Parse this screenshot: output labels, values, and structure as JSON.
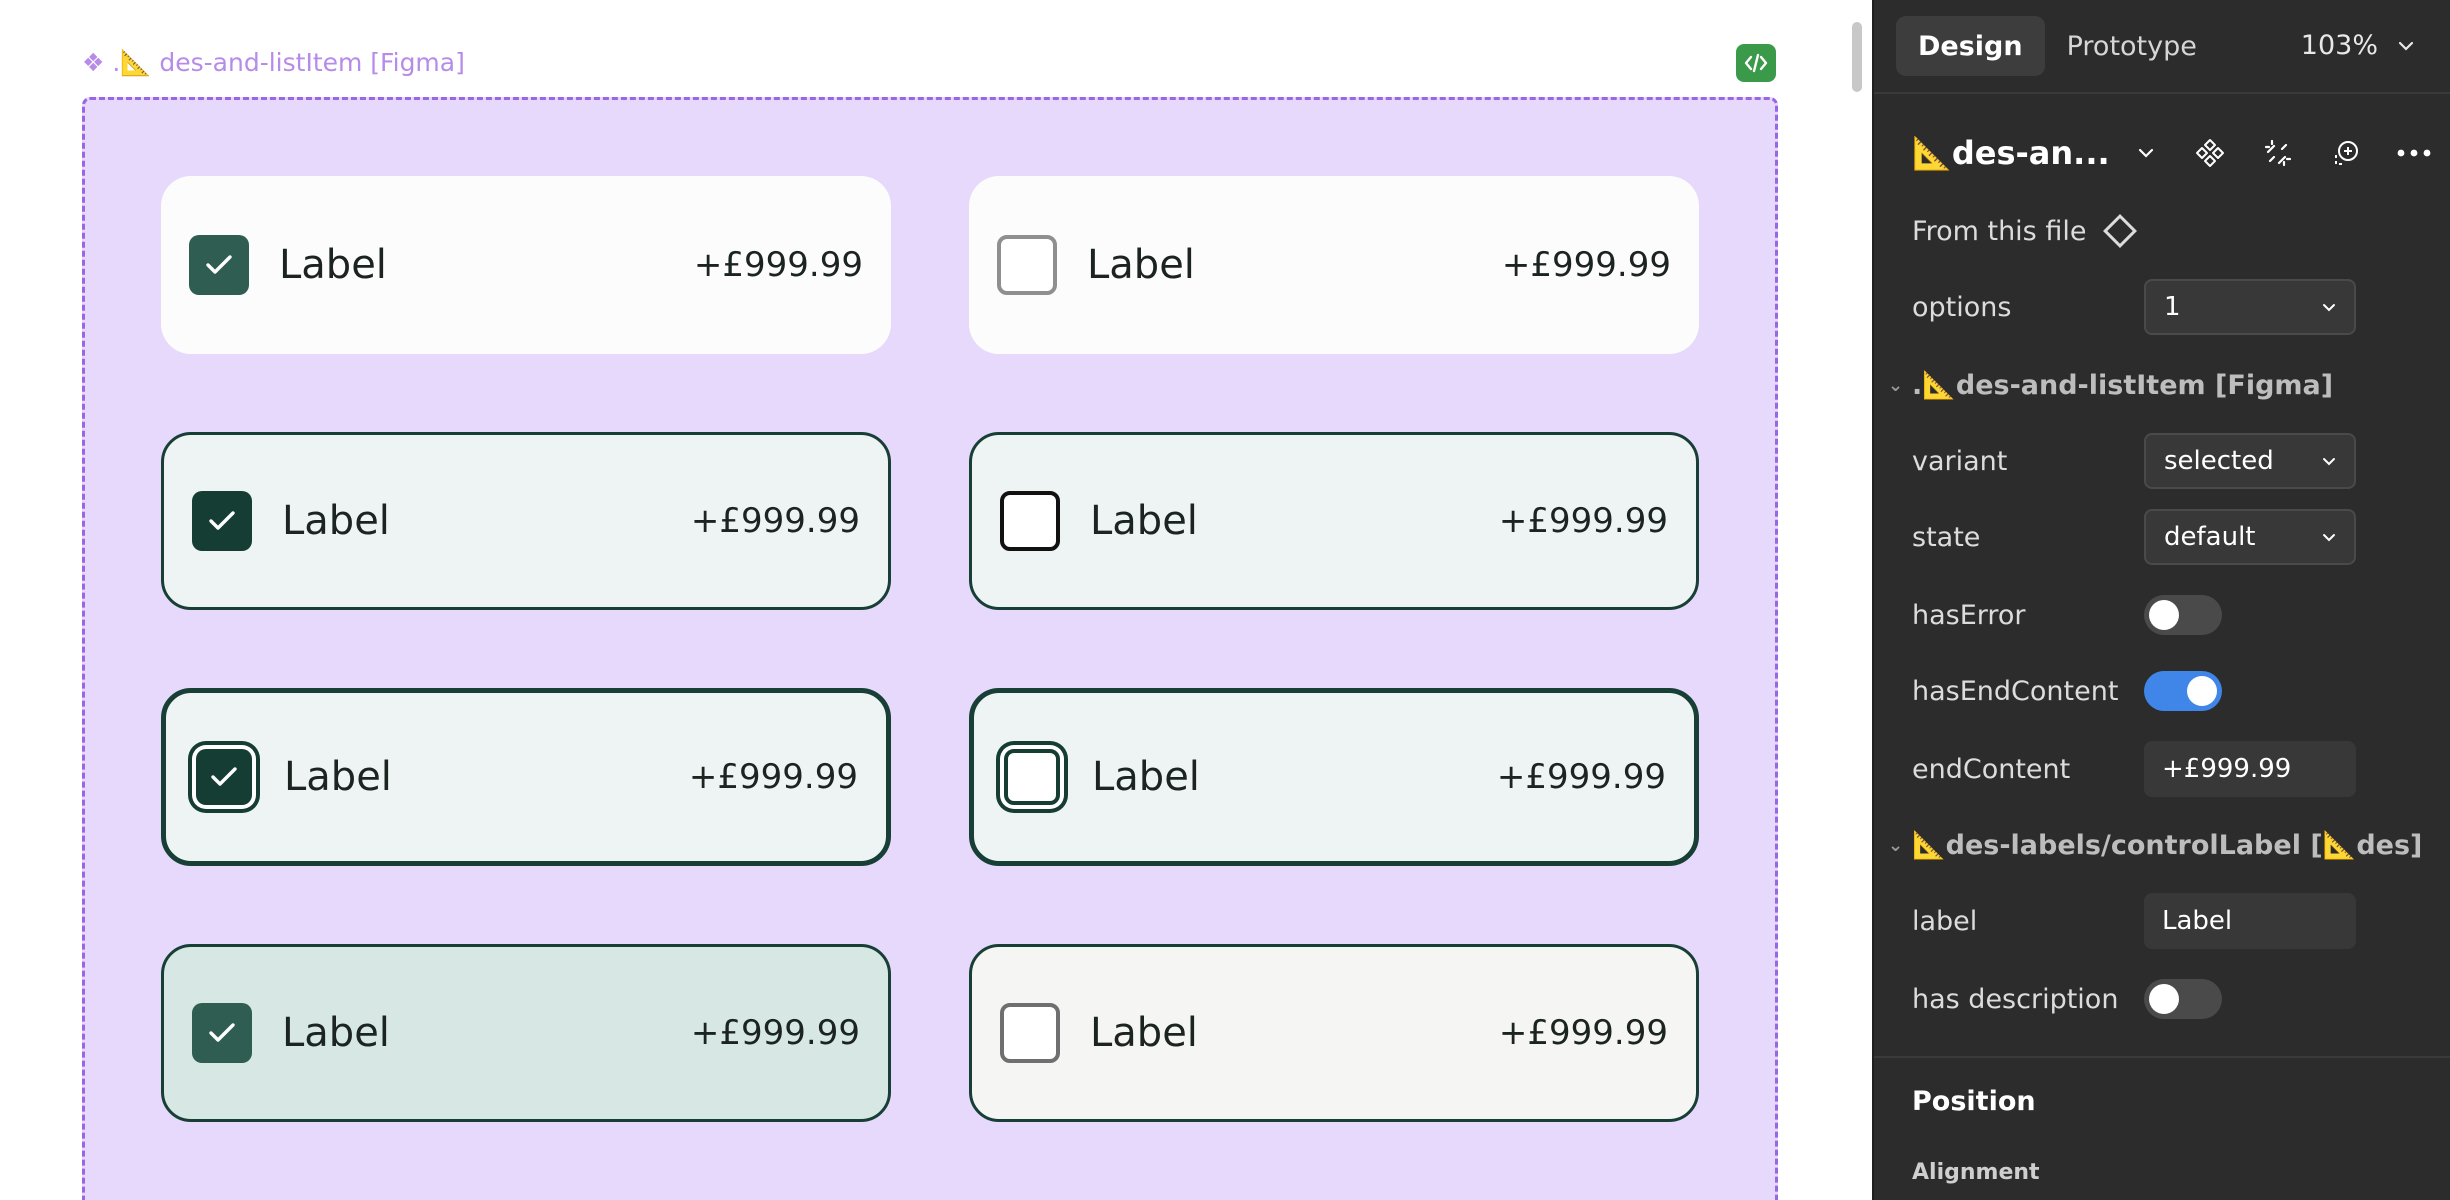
{
  "canvas": {
    "frame_title": "❖ .📐 des-and-listItem [Figma]",
    "code_badge_icon": "code-icon",
    "items": [
      {
        "label": "Label",
        "amount": "+£999.99",
        "checked": true
      },
      {
        "label": "Label",
        "amount": "+£999.99",
        "checked": false
      },
      {
        "label": "Label",
        "amount": "+£999.99",
        "checked": true
      },
      {
        "label": "Label",
        "amount": "+£999.99",
        "checked": false
      },
      {
        "label": "Label",
        "amount": "+£999.99",
        "checked": true
      },
      {
        "label": "Label",
        "amount": "+£999.99",
        "checked": false
      },
      {
        "label": "Label",
        "amount": "+£999.99",
        "checked": true
      },
      {
        "label": "Label",
        "amount": "+£999.99",
        "checked": false
      }
    ]
  },
  "panel": {
    "tabs": [
      "Design",
      "Prototype"
    ],
    "zoom": "103%",
    "component_name": "📐des-an...",
    "from_file_label": "From this file",
    "props": {
      "options_label": "options",
      "options_value": "1",
      "section1": ".📐des-and-listItem [Figma]",
      "variant_label": "variant",
      "variant_value": "selected",
      "state_label": "state",
      "state_value": "default",
      "has_error_label": "hasError",
      "has_error": false,
      "has_end_content_label": "hasEndContent",
      "has_end_content": true,
      "end_content_label": "endContent",
      "end_content_value": "+£999.99",
      "section2": "📐des-labels/controlLabel [📐des]",
      "label_label": "label",
      "label_value": "Label",
      "has_description_label": "has description",
      "has_description": false
    },
    "position_title": "Position",
    "alignment_title": "Alignment"
  },
  "colors": {
    "frame_bg": "#e6d9fb",
    "frame_border": "#9a66e6",
    "checkbox_green": "#2f5d52",
    "panel_bg": "#2c2c2c",
    "toggle_on": "#3f86e8",
    "code_badge": "#3a9a4a"
  }
}
